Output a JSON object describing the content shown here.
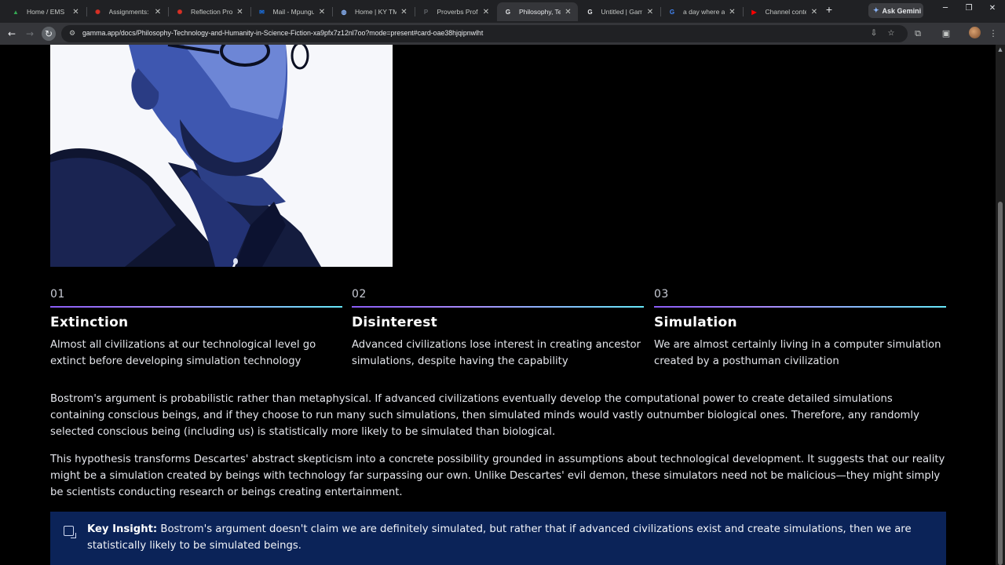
{
  "browser": {
    "tabs": [
      {
        "title": "Home / EMS",
        "icon": "ems-icon",
        "color": "#34a853",
        "glyph": "▲"
      },
      {
        "title": "Assignments: Pl",
        "icon": "canvas-icon",
        "color": "#d93025",
        "glyph": "✺"
      },
      {
        "title": "Reflection Proje",
        "icon": "canvas-icon",
        "color": "#d93025",
        "glyph": "✺"
      },
      {
        "title": "Mail - Mpungu,",
        "icon": "outlook-icon",
        "color": "#1a73e8",
        "glyph": "✉"
      },
      {
        "title": "Home | KY TMU",
        "icon": "globe-icon",
        "color": "#8ab4f8",
        "glyph": "◍"
      },
      {
        "title": "Proverbs Profits",
        "icon": "proverbs-icon",
        "color": "#5f6368",
        "glyph": "P"
      },
      {
        "title": "Philosophy, Tec",
        "icon": "gamma-icon",
        "color": "#e8eaed",
        "glyph": "G",
        "active": true
      },
      {
        "title": "Untitled | Gamm",
        "icon": "gamma-icon",
        "color": "#e8eaed",
        "glyph": "G"
      },
      {
        "title": "a day where a s",
        "icon": "google-icon",
        "color": "#4285f4",
        "glyph": "G"
      },
      {
        "title": "Channel conten",
        "icon": "youtube-icon",
        "color": "#ff0000",
        "glyph": "▶"
      }
    ],
    "new_tab": "+",
    "ask_gemini": "Ask Gemini",
    "url": "gamma.app/docs/Philosophy-Technology-and-Humanity-in-Science-Fiction-xa9pfx7z12nl7oo?mode=present#card-oae38hjqipnwlht"
  },
  "columns": [
    {
      "num": "01",
      "title": "Extinction",
      "desc": "Almost all civilizations at our technological level go extinct before developing simulation technology"
    },
    {
      "num": "02",
      "title": "Disinterest",
      "desc": "Advanced civilizations lose interest in creating ancestor simulations, despite having the capability"
    },
    {
      "num": "03",
      "title": "Simulation",
      "desc": "We are almost certainly living in a computer simulation created by a posthuman civilization"
    }
  ],
  "paragraphs": [
    "Bostrom's argument is probabilistic rather than metaphysical. If advanced civilizations eventually develop the computational power to create detailed simulations containing conscious beings, and if they choose to run many such simulations, then simulated minds would vastly outnumber biological ones. Therefore, any randomly selected conscious being (including us) is statistically more likely to be simulated than biological.",
    "This hypothesis transforms Descartes' abstract skepticism into a concrete possibility grounded in assumptions about technological development. It suggests that our reality might be a simulation created by beings with technology far surpassing our own. Unlike Descartes' evil demon, these simulators need not be malicious—they might simply be scientists conducting research or beings creating entertainment."
  ],
  "callout": {
    "label": "Key Insight:",
    "text": " Bostrom's argument doesn't claim we are definitely simulated, but rather that if advanced civilizations exist and create simulations, then we are statistically likely to be simulated beings."
  },
  "colors": {
    "page_bg": "#000000",
    "callout_bg": "#0b2358",
    "rule_gradient_start": "#8a5cf6",
    "rule_gradient_end": "#67e8f9"
  }
}
